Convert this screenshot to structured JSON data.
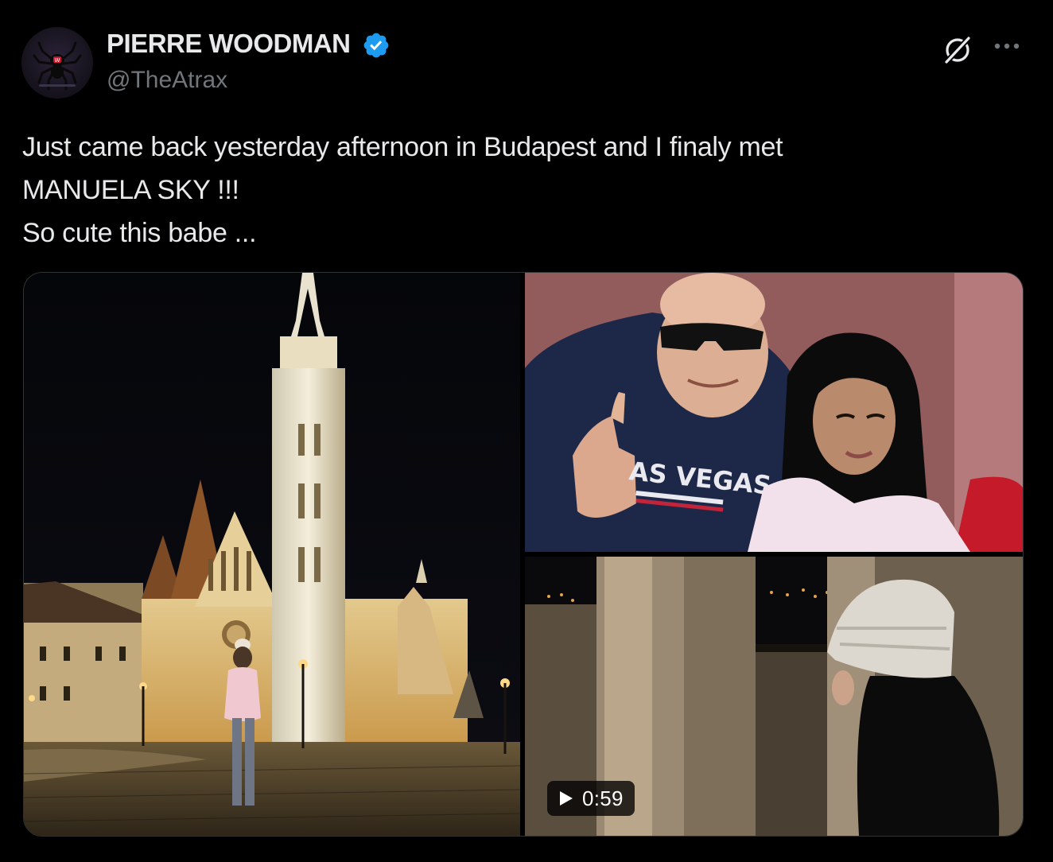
{
  "author": {
    "display_name": "PIERRE WOODMAN",
    "handle": "@TheAtrax",
    "verified": true,
    "avatar_icon": "spider-logo-icon"
  },
  "actions": {
    "grok_icon": "grok-icon",
    "more_icon": "more-icon"
  },
  "tweet": {
    "lines": [
      "Just came back yesterday afternoon in Budapest and I finaly met",
      "MANUELA SKY !!!",
      "So cute this babe ..."
    ]
  },
  "media": {
    "video": {
      "duration": "0:59",
      "play_icon": "play-icon"
    }
  },
  "colors": {
    "background": "#000000",
    "text": "#e7e9ea",
    "secondary_text": "#71767b",
    "verified_blue": "#1d9bf0",
    "border": "#2f3336"
  }
}
